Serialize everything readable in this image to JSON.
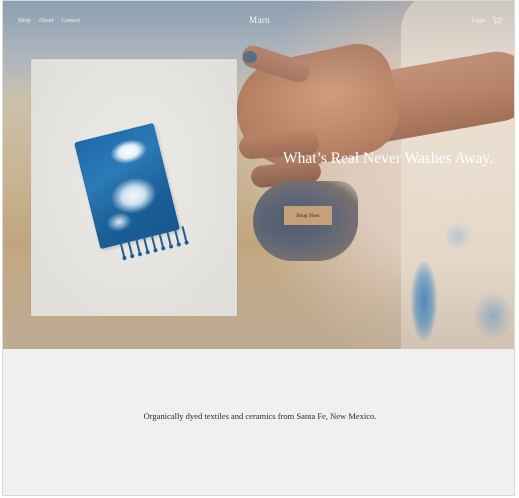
{
  "nav": {
    "links": [
      "Shop",
      "About",
      "Contact"
    ],
    "brand": "Marn",
    "login": "Login"
  },
  "icons": {
    "cart": "cart-icon"
  },
  "hero": {
    "title": "What’s Real Never Washes Away.",
    "button": "Shop Now"
  },
  "intro": {
    "text": "Organically dyed textiles and ceramics from Santa Fe, New Mexico."
  },
  "colors": {
    "button_bg": "#c6a07b",
    "hero_text": "#ffffff",
    "intro_bg": "#f1f0ee",
    "indigo": "#1e6aa8"
  }
}
